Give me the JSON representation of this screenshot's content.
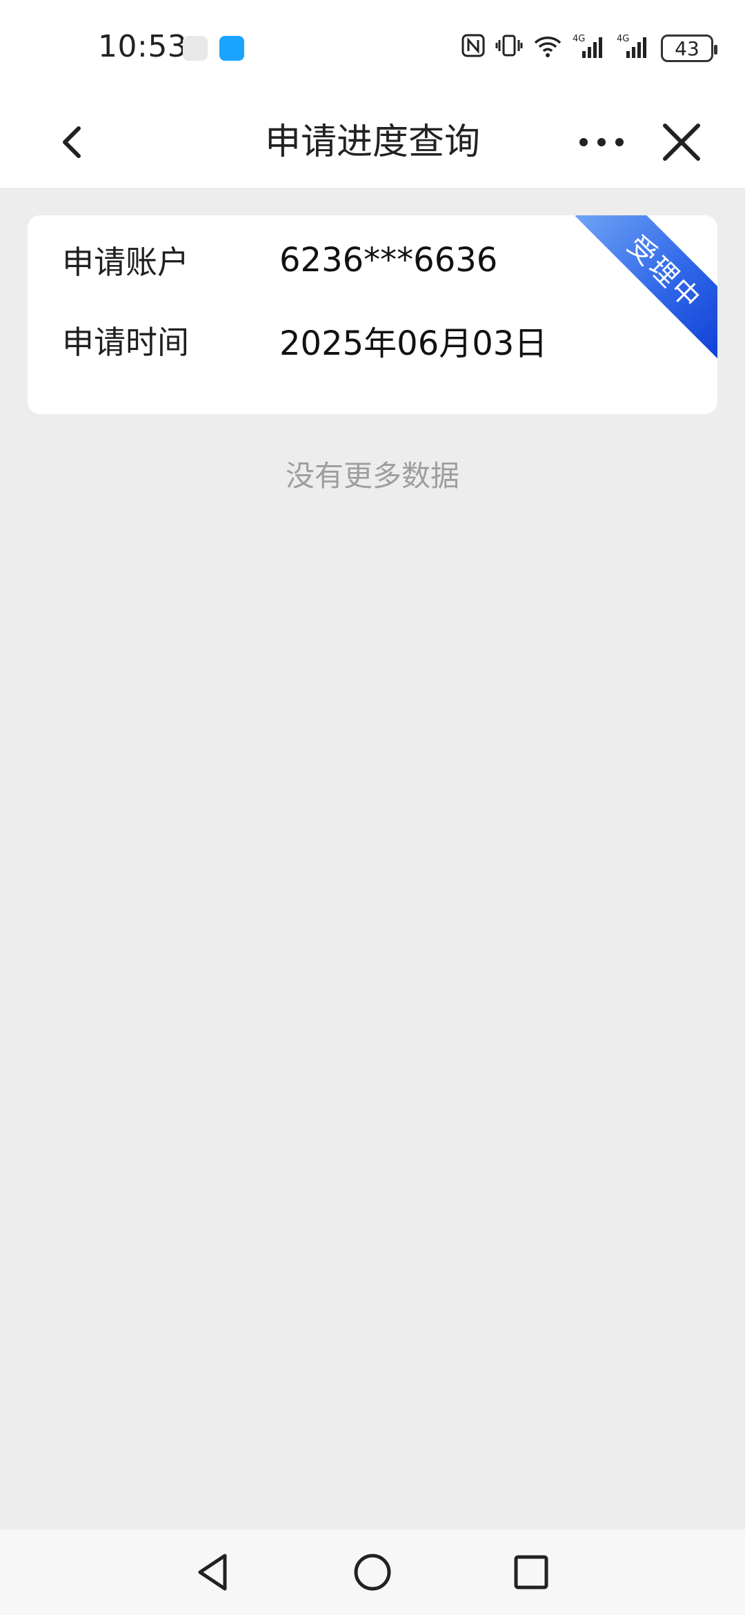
{
  "status_bar": {
    "time": "10:53",
    "battery": "43",
    "icons": [
      "nfc-icon",
      "vibrate-icon",
      "wifi-icon",
      "4g-signal-icon",
      "4g-signal-icon"
    ]
  },
  "nav": {
    "title": "申请进度查询"
  },
  "card": {
    "account_label": "申请账户",
    "account_value": "6236***6636",
    "time_label": "申请时间",
    "time_value": "2025年06月03日",
    "status_ribbon": "受理中",
    "ribbon_color": "#2f67e8"
  },
  "list_footer": "没有更多数据"
}
